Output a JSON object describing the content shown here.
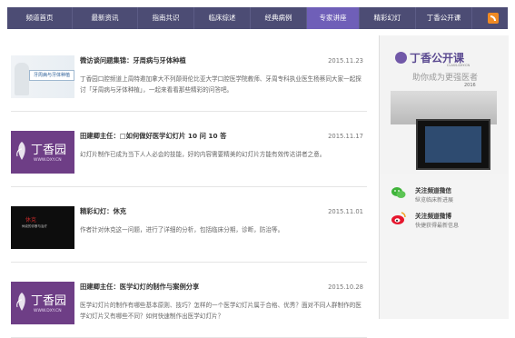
{
  "nav": {
    "items": [
      {
        "label": "频道首页",
        "active": false
      },
      {
        "label": "最新资讯",
        "active": false
      },
      {
        "label": "指南共识",
        "active": false
      },
      {
        "label": "临床综述",
        "active": false
      },
      {
        "label": "经典病例",
        "active": false
      },
      {
        "label": "专家讲座",
        "active": true
      },
      {
        "label": "精彩幻灯",
        "active": false
      },
      {
        "label": "丁香公开课",
        "active": false
      }
    ],
    "rss_icon": "rss-icon"
  },
  "articles": [
    {
      "title": "微访谈问题集锦：牙周病与牙体种植",
      "date": "2015.11.23",
      "desc": "丁香园口腔频道上周特邀加拿大不列颠哥伦比亚大学口腔医学院教师、牙周专科执业医生杨蔡同大家一起探讨「牙周病与牙体种植」，一起来看看那些精彩的问答吧。",
      "thumb_text": "牙周病与牙体种植"
    },
    {
      "title": "田建卿主任：□如何做好医学幻灯片 10 问 10 答",
      "date": "2015.11.17",
      "desc": "幻灯片制作已成为当下人人必会的技能，好的内容需要精美的幻灯片方能有效传达讲者之意。",
      "thumb_text": "丁香园",
      "thumb_sub": "WWW.DXY.CN"
    },
    {
      "title": "精彩幻灯：休克",
      "date": "2015.11.01",
      "desc": "作者针对休克这一问题，进行了详细的分析，包括临床分期，诊断，防治等。",
      "thumb_text": "休克",
      "thumb_sub": "休克的诊断与治疗"
    },
    {
      "title": "田建卿主任：医学幻灯的制作与案例分享",
      "date": "2015.10.28",
      "desc": "医学幻灯片的制作有哪些基本原则、技巧？怎样的一个医学幻灯片属于合格、优秀？面对不同人群制作的医学幻灯片又有哪些不同？如何快速制作出医学幻灯片？",
      "thumb_text": "丁香园",
      "thumb_sub": "WWW.DXY.CN"
    }
  ],
  "sidebar": {
    "ad": {
      "title": "丁香公开课",
      "url": "CLASS.DXY.CN",
      "slogan": "助你成为更强医者",
      "year": "2016"
    },
    "follow": [
      {
        "title": "关注频道微信",
        "sub": "纵览临床新进展",
        "icon": "wechat-icon",
        "color": "#3fb33a"
      },
      {
        "title": "关注频道微博",
        "sub": "快捷获得最新信息",
        "icon": "weibo-icon",
        "color": "#e6162d"
      }
    ]
  }
}
